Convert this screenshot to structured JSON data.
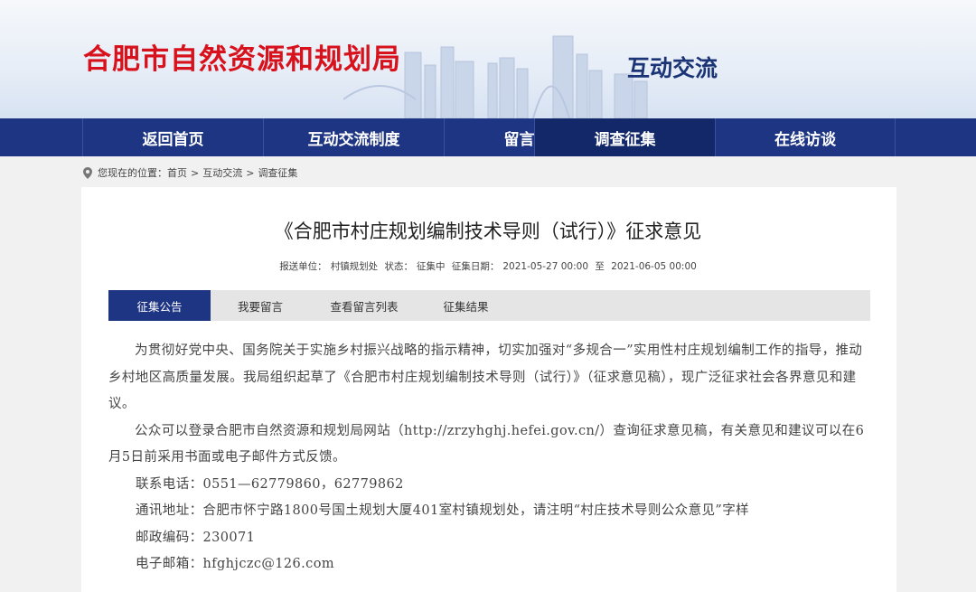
{
  "header": {
    "site_title": "合肥市自然资源和规划局",
    "section_title": "互动交流"
  },
  "nav": {
    "items": [
      "返回首页",
      "互动交流制度",
      "留言选登",
      "调查征集",
      "在线访谈"
    ],
    "active": "调查征集"
  },
  "breadcrumb": {
    "prefix": "您现在的位置：",
    "items": [
      "首页",
      "互动交流",
      "调查征集"
    ],
    "separator": ">"
  },
  "article": {
    "title": "《合肥市村庄规划编制技术导则（试行）》征求意见",
    "meta": {
      "unit_label": "报送单位：",
      "unit": "村镇规划处",
      "status_label": "状态：",
      "status": "征集中",
      "date_label": "征集日期：",
      "start": "2021-05-27 00:00",
      "to": "至",
      "end": "2021-06-05 00:00"
    }
  },
  "tabs": [
    "征集公告",
    "我要留言",
    "查看留言列表",
    "征集结果"
  ],
  "content": {
    "para1": "为贯彻好党中央、国务院关于实施乡村振兴战略的指示精神，切实加强对“多规合一”实用性村庄规划编制工作的指导，推动乡村地区高质量发展。我局组织起草了《合肥市村庄规划编制技术导则（试行）》（征求意见稿），现广泛征求社会各界意见和建议。",
    "para2": "公众可以登录合肥市自然资源和规划局网站（http://zrzyhghj.hefei.gov.cn/）查询征求意见稿，有关意见和建议可以在6月5日前采用书面或电子邮件方式反馈。",
    "phone": "联系电话：0551—62779860，62779862",
    "address": "通讯地址：合肥市怀宁路1800号国土规划大厦401室村镇规划处，请注明“村庄技术导则公众意见”字样",
    "postcode": "邮政编码：230071",
    "email": "电子邮箱：hfghjczc@126.com"
  }
}
